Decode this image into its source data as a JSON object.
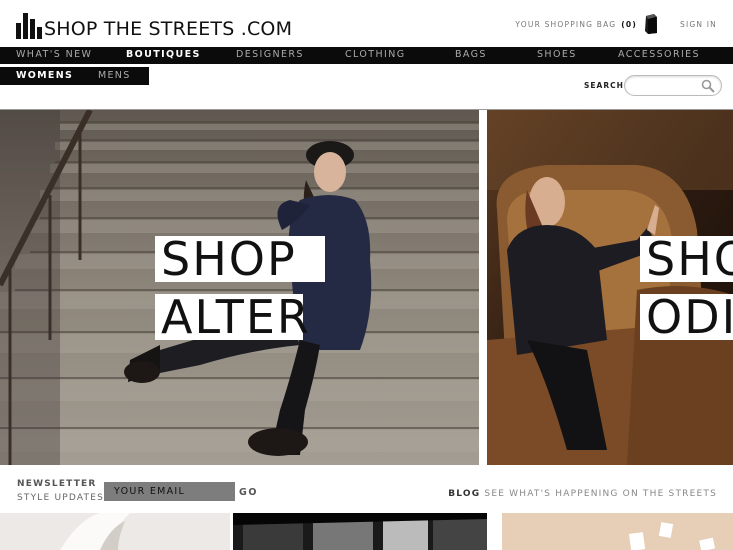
{
  "header": {
    "logo_text": "SHOP THE STREETS .COM",
    "shopping_bag_label": "YOUR SHOPPING BAG",
    "bag_count": "(0)",
    "sign_in": "SIGN IN"
  },
  "main_nav": [
    {
      "label": "WHAT'S NEW"
    },
    {
      "label": "BOUTIQUES"
    },
    {
      "label": "DESIGNERS"
    },
    {
      "label": "CLOTHING"
    },
    {
      "label": "BAGS"
    },
    {
      "label": "SHOES"
    },
    {
      "label": "ACCESSORIES"
    }
  ],
  "sub_nav": [
    {
      "label": "WOMENS"
    },
    {
      "label": "MENS"
    }
  ],
  "search": {
    "label": "SEARCH",
    "value": "",
    "placeholder": ""
  },
  "hero": {
    "left_banner_line1": "SHOP",
    "left_banner_line2": "ALTER",
    "right_banner_line1": "SHO",
    "right_banner_line2": "ODI"
  },
  "newsletter": {
    "line1": "NEWSLETTER",
    "line2": "STYLE UPDATES",
    "input_placeholder": "YOUR EMAIL",
    "go_label": "GO"
  },
  "blog": {
    "label": "BLOG",
    "text": "SEE WHAT'S HAPPENING ON THE STREETS"
  },
  "colors": {
    "nav_bg": "#0b0b0b",
    "active_nav": "#ffffff",
    "inactive_nav": "#aaaaaa",
    "newsletter_input": "#7d7d7d"
  }
}
